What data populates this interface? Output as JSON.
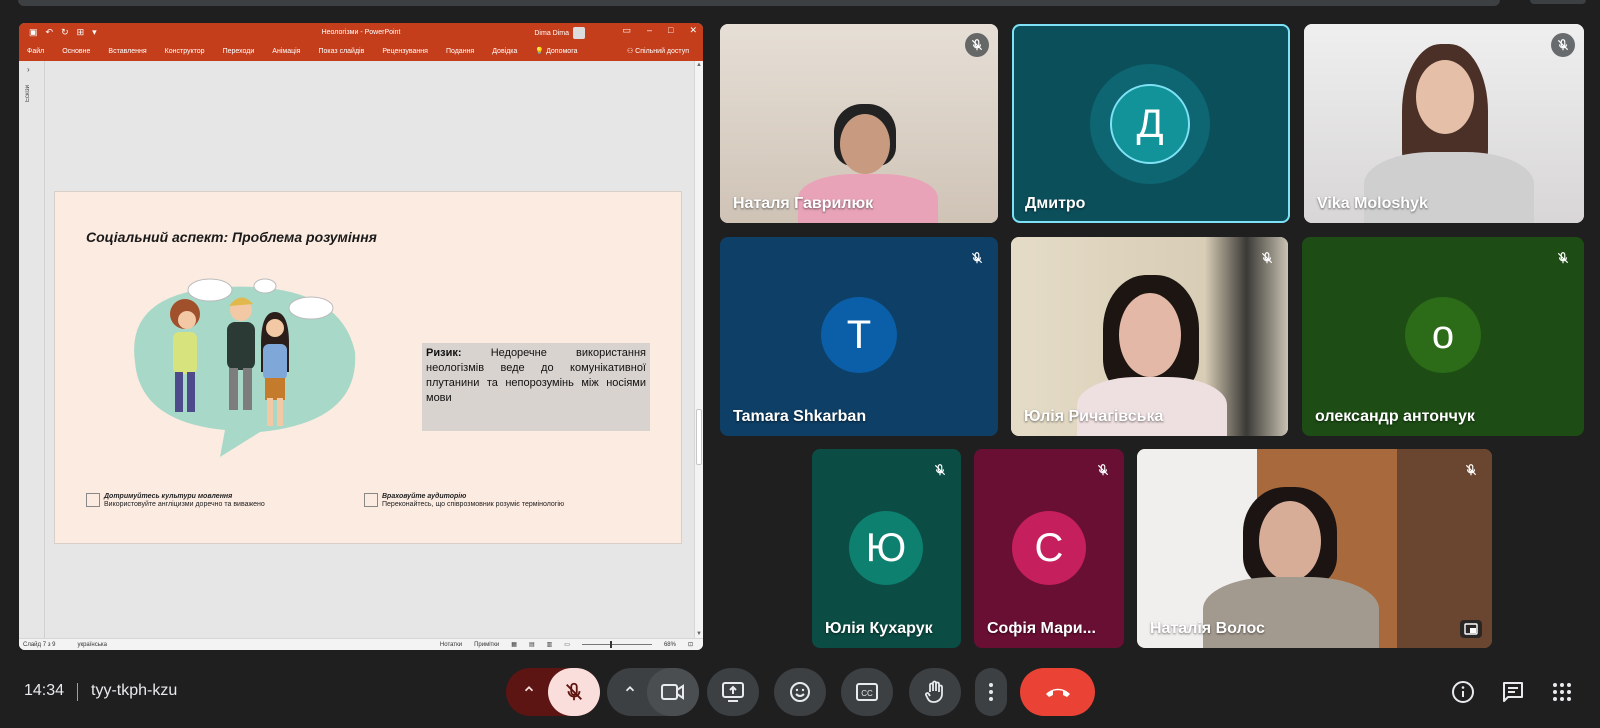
{
  "window": {
    "title": "Неологізми - PowerPoint",
    "user": "Dima Dima"
  },
  "ribbon": {
    "tabs": [
      "Файл",
      "Основне",
      "Вставлення",
      "Конструктор",
      "Переходи",
      "Анімація",
      "Показ слайдів",
      "Рецензування",
      "Подання",
      "Довідка",
      "Допомога"
    ],
    "share": "Спільний доступ"
  },
  "side_panel": {
    "label": "Ескізи"
  },
  "slide": {
    "title": "Соціальний аспект: Проблема розуміння",
    "risk_label": "Ризик:",
    "risk_text": "Недоречне використання неологізмів веде до комунікативної плутанини та непорозумінь між носіями мови",
    "tips": [
      {
        "title": "Дотримуйтесь культури мовлення",
        "text": "Використовуйте англіцизми доречно та виважено"
      },
      {
        "title": "Враховуйте аудиторію",
        "text": "Переконайтесь, що співрозмовник розуміє термінологію"
      }
    ]
  },
  "status_bar": {
    "slide": "Слайд 7 з 9",
    "language": "українська",
    "notes": "Нотатки",
    "comments": "Примітки",
    "zoom": "68%"
  },
  "participants": [
    {
      "name": "Наталя Гаврилюк",
      "muted": true,
      "video": true
    },
    {
      "name": "Дмитро",
      "initial": "Д",
      "muted": false,
      "video": false,
      "active": true,
      "color": "#12939a"
    },
    {
      "name": "Vika Moloshyk",
      "muted": true,
      "video": true
    },
    {
      "name": "Tamara Shkarban",
      "initial": "T",
      "muted": true,
      "video": false,
      "color": "#0b5ea8"
    },
    {
      "name": "Юлія Ричагівська",
      "muted": true,
      "video": true
    },
    {
      "name": "олександр антончук",
      "initial": "о",
      "muted": true,
      "video": false,
      "color": "#2c6b18"
    },
    {
      "name": "Юлія Кухарук",
      "initial": "Ю",
      "muted": true,
      "video": false,
      "color": "#0e8070"
    },
    {
      "name": "Софія Мари...",
      "initial": "С",
      "muted": true,
      "video": false,
      "color": "#c51f5d"
    },
    {
      "name": "Наталія Волос",
      "muted": true,
      "video": true
    }
  ],
  "meeting": {
    "time": "14:34",
    "code": "tyy-tkph-kzu"
  },
  "colors": {
    "background": "#1f1f1f",
    "ppt_ribbon": "#c43e1c",
    "end_call": "#ea4335",
    "muted_mic": "#f9dedc",
    "active_outline": "#7ee1f5"
  }
}
